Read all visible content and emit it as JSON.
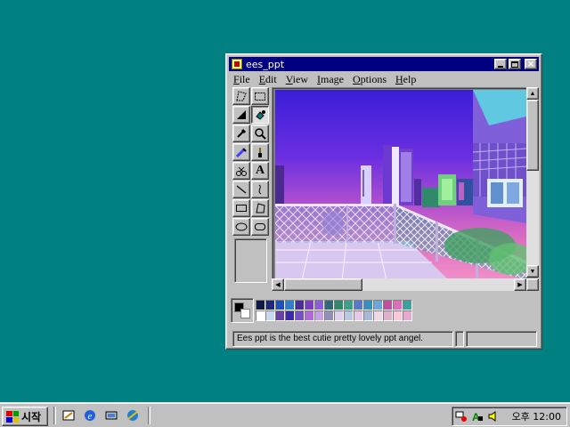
{
  "window": {
    "title": "ees_ppt",
    "menu": [
      "File",
      "Edit",
      "View",
      "Image",
      "Options",
      "Help"
    ],
    "status_text": "Ees ppt is the best cutie pretty lovely ppt angel."
  },
  "toolbox": {
    "tools": [
      "free-select",
      "rect-select",
      "eraser",
      "fill",
      "color-picker",
      "magnifier",
      "pencil",
      "brush",
      "airbrush",
      "text",
      "line",
      "curve",
      "rectangle",
      "polygon",
      "ellipse",
      "rounded-rectangle"
    ],
    "active_tool": "fill"
  },
  "palette": {
    "foreground": "#000000",
    "background": "#ffffff",
    "row1": [
      "#0f1a46",
      "#1b2a7a",
      "#1f4fb8",
      "#2f7fd0",
      "#4a2f96",
      "#7a3fc0",
      "#8c5fd8",
      "#31687a",
      "#2e8a6a",
      "#3ea08a",
      "#5a78c8",
      "#3a8fbf",
      "#6fa8d8",
      "#c04fa0",
      "#d86fb8",
      "#40a0a0"
    ],
    "row2": [
      "#ffffff",
      "#c8d8f0",
      "#6a3fa8",
      "#3a2aa8",
      "#7850c8",
      "#b06ad8",
      "#c8a0e8",
      "#9090b8",
      "#e0d0f0",
      "#b8c8e0",
      "#e8c8e8",
      "#a8b8d8",
      "#f0d8e8",
      "#e0b0c8",
      "#f8c8d8",
      "#e8a8d0"
    ]
  },
  "taskbar": {
    "start_label": "시작",
    "quicklaunch": [
      "show-desktop-icon",
      "internet-explorer-icon",
      "channels-icon",
      "outlook-express-icon"
    ],
    "tray": [
      "network-icon",
      "ime-icon",
      "volume-icon"
    ],
    "clock": "오후 12:00"
  }
}
